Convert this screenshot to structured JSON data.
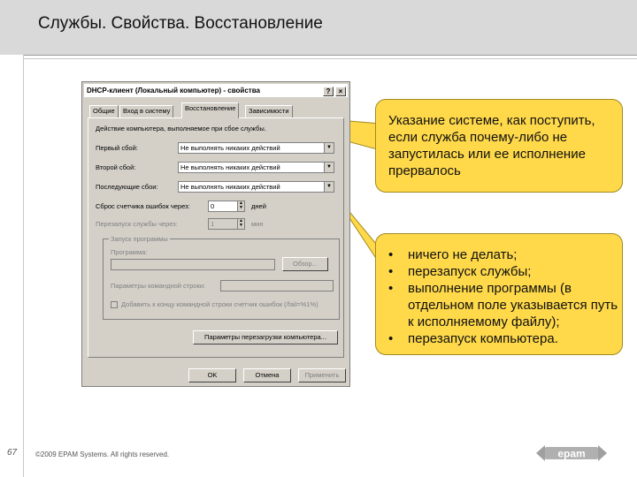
{
  "slide": {
    "title": "Службы. Свойства. Восстановление",
    "page_number": "67",
    "copyright": "©2009 EPAM Systems. All rights reserved.",
    "logo_text": "epam"
  },
  "dialog": {
    "title": "DHCP-клиент (Локальный компьютер) - свойства",
    "help_label": "?",
    "close_label": "×",
    "tabs": [
      {
        "label": "Общие"
      },
      {
        "label": "Вход в систему"
      },
      {
        "label": "Восстановление"
      },
      {
        "label": "Зависимости"
      }
    ],
    "active_tab": "Восстановление",
    "intro": "Действие компьютера, выполняемое при сбое службы.",
    "first_failure_label": "Первый сбой:",
    "first_failure_value": "Не выполнять никаких действий",
    "second_failure_label": "Второй сбой:",
    "second_failure_value": "Не выполнять никаких действий",
    "subsequent_failure_label": "Последующие сбои:",
    "subsequent_failure_value": "Не выполнять никаких действий",
    "reset_count_label": "Сброс счетчика ошибок через:",
    "reset_count_value": "0",
    "reset_count_unit": "дней",
    "restart_service_label": "Перезапуск службы через:",
    "restart_service_value": "1",
    "restart_service_unit": "мин",
    "run_program_group": "Запуск программы",
    "program_label": "Программа:",
    "browse_label": "Обзор...",
    "params_label": "Параметры командной строки:",
    "append_failcount_label": "Добавить к концу командной строки счетчик ошибок (/fail=%1%)",
    "restart_options_label": "Параметры перезагрузки компьютера...",
    "ok_label": "OK",
    "cancel_label": "Отмена",
    "apply_label": "Применить"
  },
  "callouts": {
    "top": "Указание системе, как поступить, если служба почему-либо не запустилась или ее исполнение прервалось",
    "bullet": "•",
    "options": [
      "ничего не делать;",
      "перезапуск службы;",
      "выполнение программы (в отдельном поле указывается путь к исполняемому файлу);",
      "перезапуск компьютера."
    ]
  },
  "colors": {
    "callout": "#ffd94a",
    "dialog_bg": "#d4d0c8",
    "header_bg": "#d9d9d9"
  }
}
